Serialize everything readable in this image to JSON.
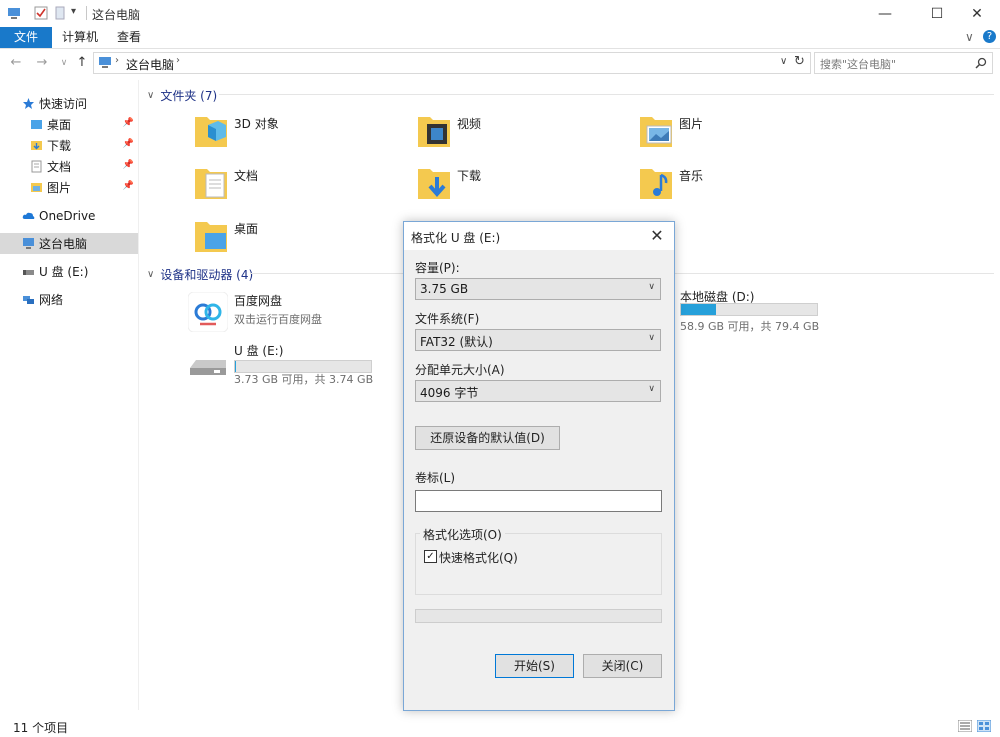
{
  "window": {
    "title": "这台电脑",
    "controls": {
      "minimize": "—",
      "maximize": "☐",
      "close": "✕"
    }
  },
  "ribbon": {
    "tabs": [
      "文件",
      "计算机",
      "查看"
    ],
    "help": "?",
    "expand": "∨"
  },
  "address": {
    "path": "这台电脑",
    "search_placeholder": "搜索\"这台电脑\""
  },
  "sidebar": {
    "quick_access": "快速访问",
    "quick_items": [
      {
        "label": "桌面",
        "pinned": true
      },
      {
        "label": "下载",
        "pinned": true
      },
      {
        "label": "文档",
        "pinned": true
      },
      {
        "label": "图片",
        "pinned": true
      }
    ],
    "onedrive": "OneDrive",
    "this_pc": "这台电脑",
    "usb": "U 盘 (E:)",
    "network": "网络"
  },
  "main": {
    "folders_header": "文件夹 (7)",
    "folders": [
      {
        "label": "3D 对象",
        "icon": "3d-objects-folder-icon"
      },
      {
        "label": "视频",
        "icon": "videos-folder-icon"
      },
      {
        "label": "图片",
        "icon": "pictures-folder-icon"
      },
      {
        "label": "文档",
        "icon": "documents-folder-icon"
      },
      {
        "label": "下载",
        "icon": "downloads-folder-icon"
      },
      {
        "label": "音乐",
        "icon": "music-folder-icon"
      },
      {
        "label": "桌面",
        "icon": "desktop-folder-icon"
      }
    ],
    "devices_header": "设备和驱动器 (4)",
    "devices": [
      {
        "name": "百度网盘",
        "sub": "双击运行百度网盘",
        "icon": "baidu-netdisk-icon"
      },
      {
        "name": "U 盘 (E:)",
        "sub": "3.73 GB 可用，共 3.74 GB",
        "icon": "usb-drive-icon",
        "used_fraction": 0.003
      },
      {
        "name": "本地磁盘 (D:)",
        "sub": "58.9 GB 可用，共 79.4 GB",
        "icon": "local-disk-icon",
        "used_fraction": 0.26
      }
    ]
  },
  "status": {
    "items": "11 个项目"
  },
  "dialog": {
    "title": "格式化 U 盘 (E:)",
    "close": "✕",
    "capacity_label": "容量(P):",
    "capacity_value": "3.75 GB",
    "fs_label": "文件系统(F)",
    "fs_value": "FAT32 (默认)",
    "alloc_label": "分配单元大小(A)",
    "alloc_value": "4096 字节",
    "restore_button": "还原设备的默认值(D)",
    "volume_label": "卷标(L)",
    "volume_value": "",
    "options_legend": "格式化选项(O)",
    "quick_format_label": "快速格式化(Q)",
    "quick_format_checked": true,
    "progress": 0,
    "start_button": "开始(S)",
    "close_button": "关闭(C)"
  },
  "colors": {
    "accent": "#1979ca",
    "drive_bar": "#26a0da",
    "folder": "#f4c94f"
  }
}
